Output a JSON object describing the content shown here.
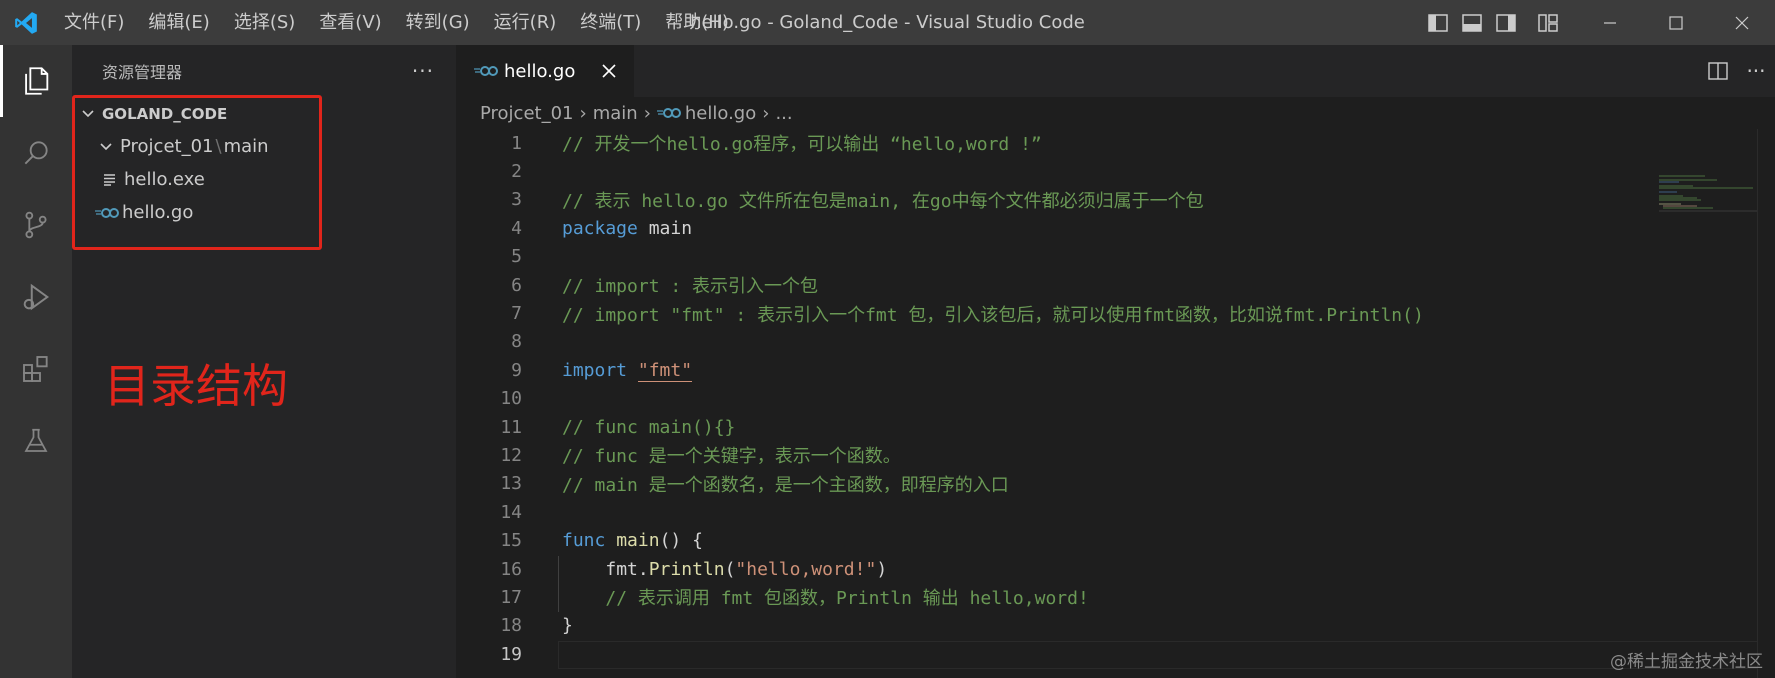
{
  "window": {
    "title": "hello.go - Goland_Code - Visual Studio Code",
    "menu": [
      "文件(F)",
      "编辑(E)",
      "选择(S)",
      "查看(V)",
      "转到(G)",
      "运行(R)",
      "终端(T)",
      "帮助(H)"
    ]
  },
  "sidebar": {
    "title": "资源管理器",
    "more": "···",
    "root": "GOLAND_CODE",
    "folder": "Projcet_01",
    "folder_sep": "\\",
    "subfolder": "main",
    "files": [
      "hello.exe",
      "hello.go"
    ]
  },
  "annotation": {
    "text": "目录结构",
    "color": "#e1251b"
  },
  "editor": {
    "tab_label": "hello.go",
    "breadcrumb": [
      "Projcet_01",
      "main",
      "hello.go",
      "..."
    ],
    "line_numbers": [
      "1",
      "2",
      "3",
      "4",
      "5",
      "6",
      "7",
      "8",
      "9",
      "10",
      "11",
      "12",
      "13",
      "14",
      "15",
      "16",
      "17",
      "18",
      "19"
    ],
    "current_line": "19",
    "code": {
      "l1": "// 开发一个hello.go程序，可以输出 “hello,word !”",
      "l3": "// 表示 hello.go 文件所在包是main, 在go中每个文件都必须归属于一个包",
      "l4_kw": "package",
      "l4_rest": " main",
      "l6": "// import : 表示引入一个包",
      "l7": "// import \"fmt\" : 表示引入一个fmt 包，引入该包后，就可以使用fmt函数，比如说fmt.Println()",
      "l9_kw": "import",
      "l9_str": "\"fmt\"",
      "l11": "// func main(){}",
      "l12": "// func 是一个关键字，表示一个函数。",
      "l13": "// main 是一个函数名，是一个主函数，即程序的入口",
      "l15_kw": "func",
      "l15_fn": "main",
      "l15_rest": "() {",
      "l16_obj": "fmt.",
      "l16_fn": "Println",
      "l16_open": "(",
      "l16_str": "\"hello,word!\"",
      "l16_close": ")",
      "l17": "// 表示调用 fmt 包函数，Println 输出 hello,word!",
      "l18": "}"
    }
  },
  "watermark": "@稀土掘金技术社区",
  "colors": {
    "accent": "#007acc",
    "titlebar": "#3c3c3c",
    "comment": "#6a9955",
    "keyword": "#569cd6",
    "string": "#ce9178",
    "function": "#dcdcaa",
    "go_icon": "#519aba"
  },
  "icons": {
    "activity": [
      "explorer-icon",
      "search-icon",
      "source-control-icon",
      "run-debug-icon",
      "extensions-icon",
      "testing-icon"
    ],
    "title": [
      "vscode-logo",
      "toggle-sidebar-icon",
      "toggle-panel-icon",
      "toggle-secondary-sidebar-icon",
      "customize-layout-icon",
      "minimize-icon",
      "maximize-icon",
      "close-window-icon"
    ]
  }
}
